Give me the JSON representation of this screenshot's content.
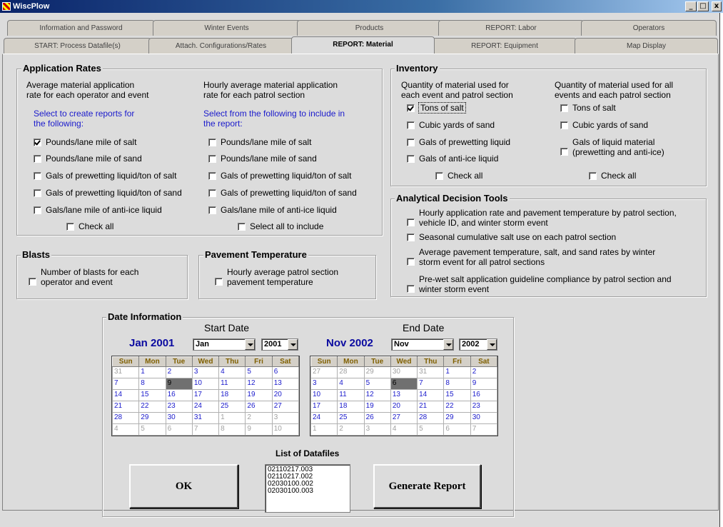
{
  "window": {
    "title": "WiscPlow",
    "min_glyph": "_",
    "max_glyph": "□",
    "close_glyph": "x"
  },
  "tabs_row1": [
    "Information and Password",
    "Winter Events",
    "Products",
    "REPORT: Labor",
    "Operators"
  ],
  "tabs_row2": [
    "START: Process Datafile(s)",
    "Attach. Configurations/Rates",
    "REPORT: Material",
    "REPORT: Equipment",
    "Map Display"
  ],
  "active_tab": "REPORT: Material",
  "application_rates": {
    "title": "Application Rates",
    "col1": {
      "desc1": "Average material application",
      "desc2": "rate for each operator and event",
      "select1": "Select to create reports for",
      "select2": "the following:",
      "options": [
        {
          "label": "Pounds/lane mile of salt",
          "checked": true
        },
        {
          "label": "Pounds/lane mile of sand",
          "checked": false
        },
        {
          "label": "Gals of prewetting liquid/ton of salt",
          "checked": false
        },
        {
          "label": "Gals of prewetting liquid/ton of sand",
          "checked": false
        },
        {
          "label": "Gals/lane mile of anti-ice liquid",
          "checked": false
        }
      ],
      "check_all": "Check all"
    },
    "col2": {
      "desc1": "Hourly average material application",
      "desc2": "rate for each patrol section",
      "select1": "Select from the following to include in",
      "select2": "the report:",
      "options": [
        {
          "label": "Pounds/lane mile of salt",
          "checked": false
        },
        {
          "label": "Pounds/lane mile of sand",
          "checked": false
        },
        {
          "label": "Gals of prewetting liquid/ton of salt",
          "checked": false
        },
        {
          "label": "Gals of prewetting liquid/ton of sand",
          "checked": false
        },
        {
          "label": "Gals/lane mile of anti-ice liquid",
          "checked": false
        }
      ],
      "check_all": "Select all to include"
    }
  },
  "inventory": {
    "title": "Inventory",
    "col1": {
      "desc1": "Quantity of material used for",
      "desc2": "each event and patrol section",
      "options": [
        {
          "label": "Tons of salt",
          "checked": true
        },
        {
          "label": "Cubic yards of sand",
          "checked": false
        },
        {
          "label": "Gals of prewetting liquid",
          "checked": false
        },
        {
          "label": "Gals of anti-ice liquid",
          "checked": false
        }
      ],
      "check_all": "Check all"
    },
    "col2": {
      "desc1": "Quantity of material used for all",
      "desc2": "events and each patrol section",
      "opt1": "Tons of salt",
      "opt2": "Cubic yards of sand",
      "opt3a": "Gals of liquid material",
      "opt3b": "(prewetting and anti-ice)",
      "check_all": "Check all"
    }
  },
  "analytical": {
    "title": "Analytical Decision Tools",
    "opt1a": "Hourly application rate and pavement temperature by patrol section,",
    "opt1b": "vehicle ID, and winter storm event",
    "opt2": "Seasonal cumulative salt use on each patrol section",
    "opt3a": "Average pavement temperature, salt, and sand rates by winter",
    "opt3b": "storm event for all patrol sections",
    "opt4a": "Pre-wet salt application guideline compliance by patrol section and",
    "opt4b": "winter storm event"
  },
  "blasts": {
    "title": "Blasts",
    "opt_a": "Number of blasts for each",
    "opt_b": "operator and event"
  },
  "pavement": {
    "title": "Pavement Temperature",
    "opt_a": "Hourly average patrol section",
    "opt_b": "pavement temperature"
  },
  "date_info": {
    "title": "Date Information",
    "start": {
      "heading": "Start Date",
      "month_label": "Jan 2001",
      "month_select": "Jan",
      "year_select": "2001",
      "weeks": [
        [
          "31",
          "1",
          "2",
          "3",
          "4",
          "5",
          "6"
        ],
        [
          "7",
          "8",
          "9",
          "10",
          "11",
          "12",
          "13"
        ],
        [
          "14",
          "15",
          "16",
          "17",
          "18",
          "19",
          "20"
        ],
        [
          "21",
          "22",
          "23",
          "24",
          "25",
          "26",
          "27"
        ],
        [
          "28",
          "29",
          "30",
          "31",
          "1",
          "2",
          "3"
        ],
        [
          "4",
          "5",
          "6",
          "7",
          "8",
          "9",
          "10"
        ]
      ],
      "selected": "9"
    },
    "end": {
      "heading": "End Date",
      "month_label": "Nov 2002",
      "month_select": "Nov",
      "year_select": "2002",
      "weeks": [
        [
          "27",
          "28",
          "29",
          "30",
          "31",
          "1",
          "2"
        ],
        [
          "3",
          "4",
          "5",
          "6",
          "7",
          "8",
          "9"
        ],
        [
          "10",
          "11",
          "12",
          "13",
          "14",
          "15",
          "16"
        ],
        [
          "17",
          "18",
          "19",
          "20",
          "21",
          "22",
          "23"
        ],
        [
          "24",
          "25",
          "26",
          "27",
          "28",
          "29",
          "30"
        ],
        [
          "1",
          "2",
          "3",
          "4",
          "5",
          "6",
          "7"
        ]
      ],
      "selected": "6"
    },
    "weekdays": [
      "Sun",
      "Mon",
      "Tue",
      "Wed",
      "Thu",
      "Fri",
      "Sat"
    ]
  },
  "datafiles": {
    "title": "List of Datafiles",
    "files": [
      "02110217.003",
      "02110217.002",
      "02030100.002",
      "02030100.003"
    ]
  },
  "buttons": {
    "ok": "OK",
    "generate": "Generate Report"
  }
}
